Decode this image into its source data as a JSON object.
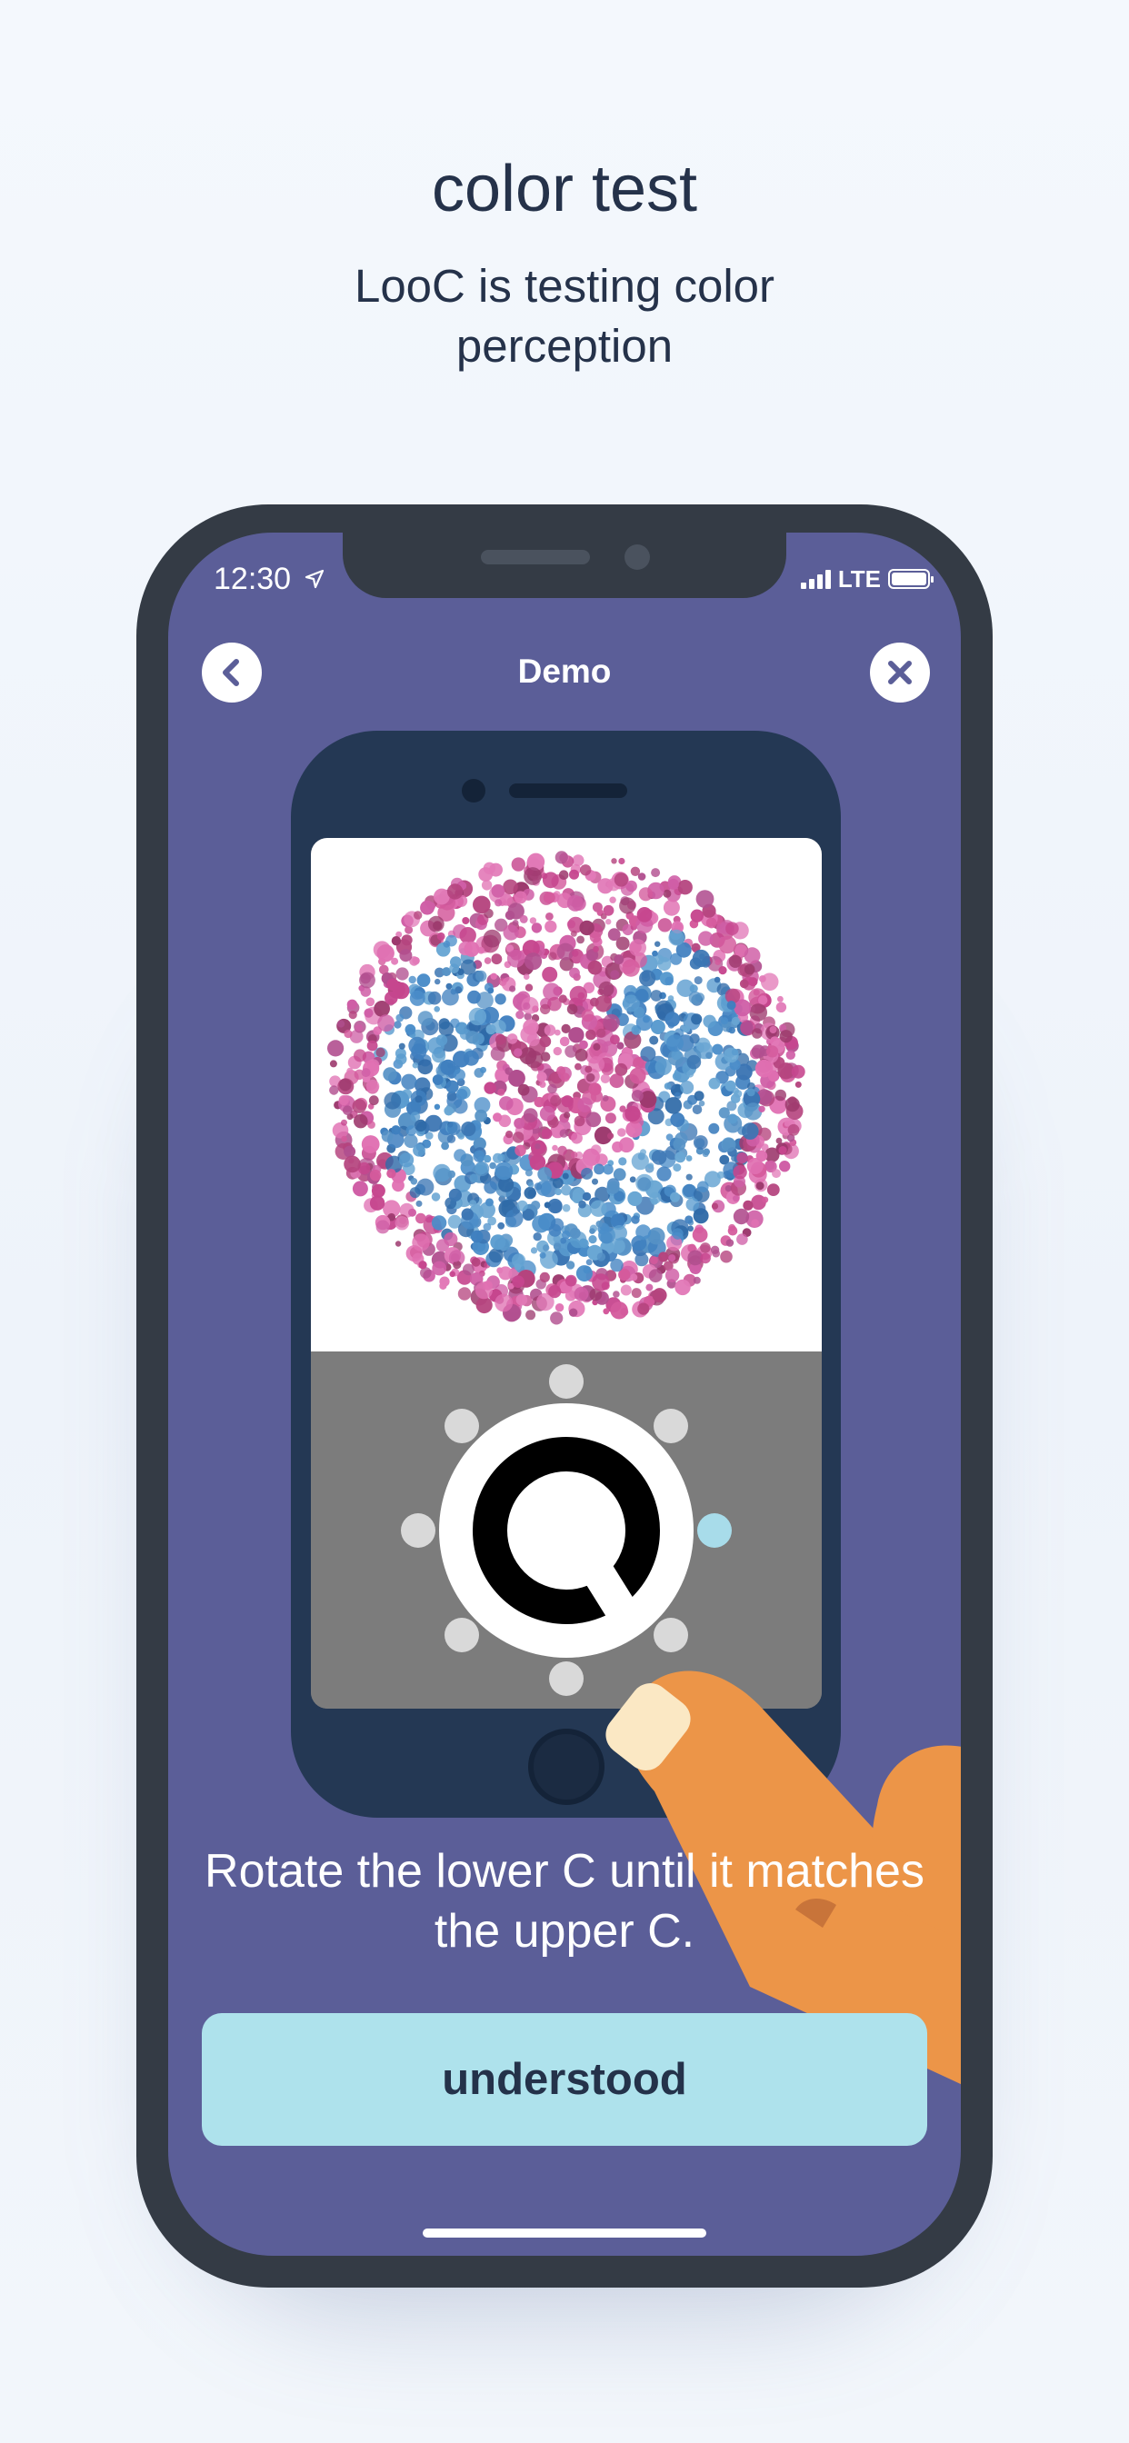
{
  "header": {
    "title": "color test",
    "subtitle": "LooC is testing color perception"
  },
  "status_bar": {
    "time": "12:30",
    "network": "LTE"
  },
  "nav": {
    "title": "Demo",
    "back_icon": "chevron-left-icon",
    "close_icon": "close-icon"
  },
  "demo": {
    "plate_letter": "C",
    "instruction": "Rotate the lower C until it matches the upper C.",
    "button_label": "understood"
  },
  "colors": {
    "screen_bg": "#5b5e98",
    "device_frame": "#343b45",
    "inner_phone": "#243854",
    "button_bg": "#aee2ec",
    "dial_active_dot": "#a8dcea",
    "hand": "#ec9548",
    "fingernail": "#fbe8c4"
  }
}
